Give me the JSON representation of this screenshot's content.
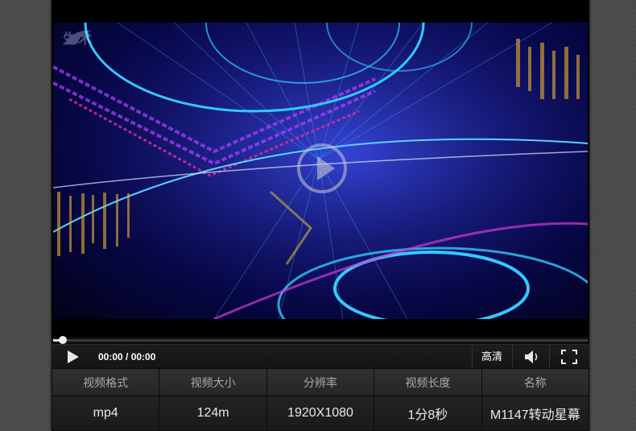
{
  "video": {
    "watermark_text": "生术",
    "play_label": "Play"
  },
  "playback": {
    "progress_fraction": 0.02
  },
  "controls": {
    "time_display": "00:00 / 00:00",
    "quality_label": "高清",
    "icons": {
      "play": "play-icon",
      "volume": "volume-icon",
      "fullscreen": "fullscreen-icon"
    }
  },
  "info_table": {
    "headers": [
      "视频格式",
      "视频大小",
      "分辨率",
      "视频长度",
      "名称"
    ],
    "values": [
      "mp4",
      "124m",
      "1920X1080",
      "1分8秒",
      "M1147转动星幕"
    ]
  },
  "colors": {
    "page_bg": "#4a4a4a",
    "player_bg": "#111111",
    "video_glow": "#2a2ab0"
  }
}
